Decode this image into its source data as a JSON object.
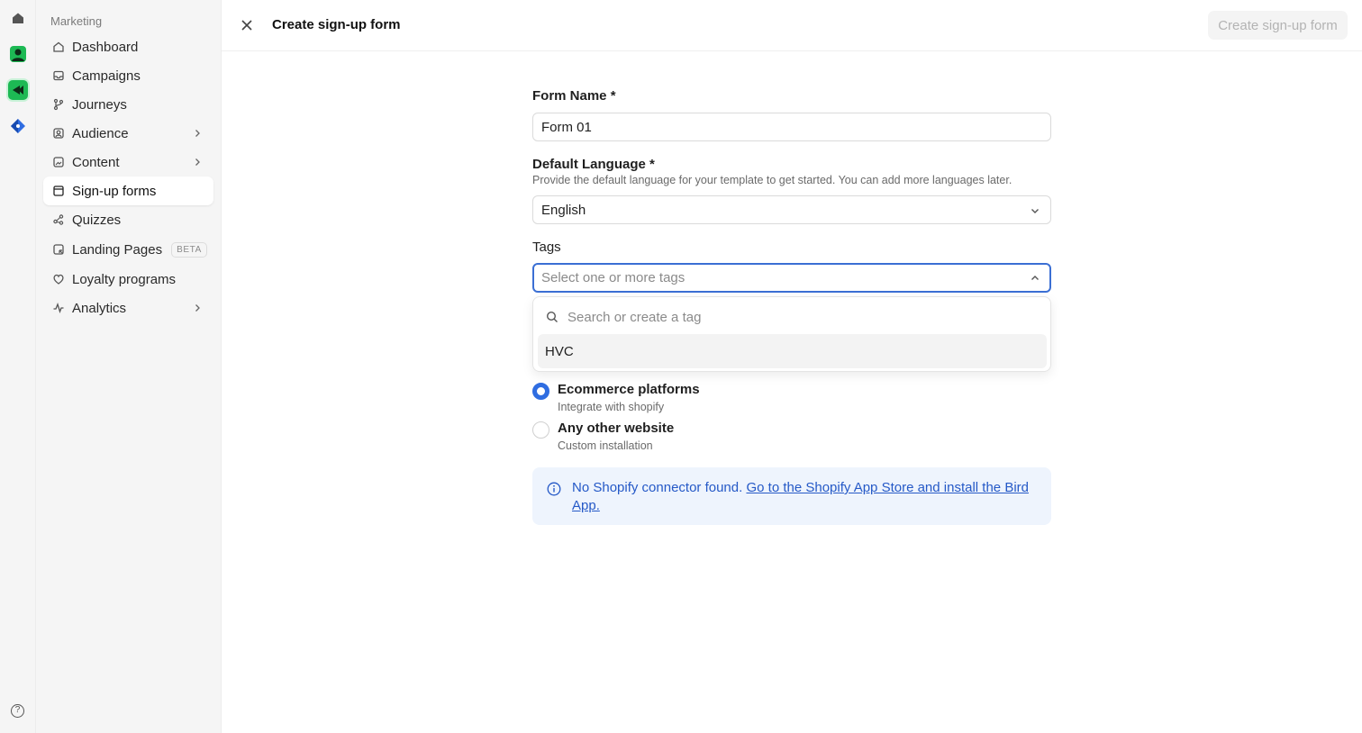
{
  "sidebar": {
    "heading": "Marketing",
    "items": [
      {
        "label": "Dashboard",
        "icon": "home-icon"
      },
      {
        "label": "Campaigns",
        "icon": "inbox-icon"
      },
      {
        "label": "Journeys",
        "icon": "branch-icon"
      },
      {
        "label": "Audience",
        "icon": "contacts-icon",
        "chevron": true
      },
      {
        "label": "Content",
        "icon": "image-icon",
        "chevron": true
      },
      {
        "label": "Sign-up forms",
        "icon": "form-icon",
        "active": true
      },
      {
        "label": "Quizzes",
        "icon": "share-icon"
      },
      {
        "label": "Landing Pages",
        "icon": "page-icon",
        "badge": "BETA"
      },
      {
        "label": "Loyalty programs",
        "icon": "heart-icon"
      },
      {
        "label": "Analytics",
        "icon": "activity-icon",
        "chevron": true
      }
    ]
  },
  "header": {
    "title": "Create sign-up form",
    "primary_button": "Create sign-up form"
  },
  "form": {
    "name": {
      "label": "Form Name *",
      "value": "Form 01"
    },
    "language": {
      "label": "Default Language *",
      "help": "Provide the default language for your template to get started. You can add more languages later.",
      "value": "English"
    },
    "tags": {
      "label": "Tags",
      "placeholder": "Select one or more tags",
      "search_placeholder": "Search or create a tag",
      "options": [
        "HVC"
      ]
    },
    "platform_options": [
      {
        "title": "Ecommerce platforms",
        "subtitle": "Integrate with shopify",
        "selected": true
      },
      {
        "title": "Any other website",
        "subtitle": "Custom installation",
        "selected": false
      }
    ],
    "alert": {
      "text": "No Shopify connector found.",
      "link": "Go to the Shopify App Store and install the Bird App."
    }
  },
  "colors": {
    "accent": "#2f6de1",
    "alert_bg": "#eef4fd",
    "alert_text": "#2559c7",
    "sidebar_bg": "#f5f5f5"
  }
}
